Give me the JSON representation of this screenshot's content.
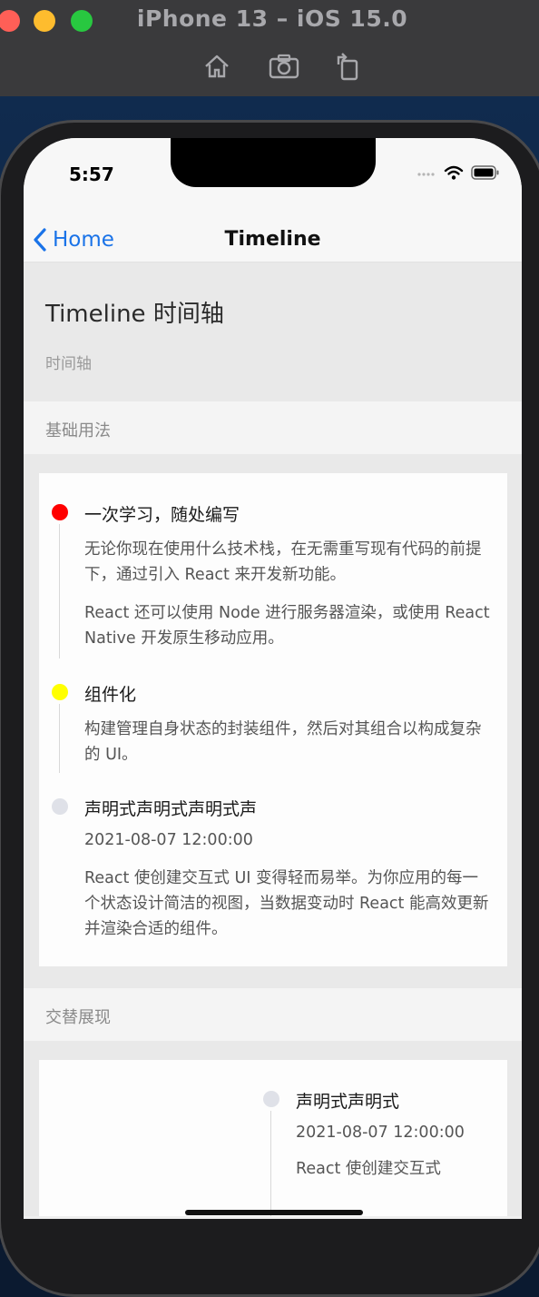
{
  "simulator": {
    "title": "iPhone 13 – iOS 15.0",
    "toolbar": [
      "home-icon",
      "screenshot-icon",
      "rotate-icon"
    ]
  },
  "status_bar": {
    "time": "5:57"
  },
  "nav": {
    "back_label": "Home",
    "title": "Timeline"
  },
  "page": {
    "title": "Timeline 时间轴",
    "description": "时间轴"
  },
  "sections": {
    "basic": {
      "heading": "基础用法",
      "items": [
        {
          "title": "一次学习，随处编写",
          "dot_color": "#ff0000",
          "paragraphs": [
            "无论你现在使用什么技术栈，在无需重写现有代码的前提下，通过引入 React 来开发新功能。",
            "React 还可以使用 Node 进行服务器渲染，或使用 React Native 开发原生移动应用。"
          ]
        },
        {
          "title": "组件化",
          "dot_color": "#ffff00",
          "paragraphs": [
            "构建管理自身状态的封装组件，然后对其组合以构成复杂的 UI。"
          ]
        },
        {
          "title": "声明式声明式声明式声",
          "dot_color": "#dfe1e8",
          "time": "2021-08-07 12:00:00",
          "paragraphs": [
            "React 使创建交互式 UI 变得轻而易举。为你应用的每一个状态设计简洁的视图，当数据变动时 React 能高效更新并渲染合适的组件。"
          ]
        }
      ]
    },
    "alternate": {
      "heading": "交替展现",
      "items": [
        {
          "title": "声明式声明式",
          "dot_color": "#dfe1e8",
          "time": "2021-08-07 12:00:00",
          "paragraphs": [
            "React 使创建交互式"
          ]
        }
      ]
    }
  }
}
